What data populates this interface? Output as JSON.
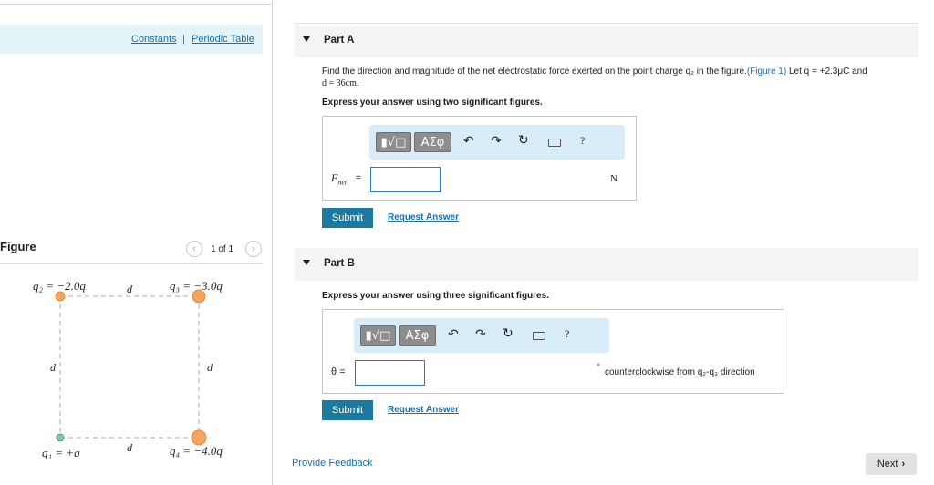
{
  "links": {
    "constants": "Constants",
    "separator": "|",
    "periodic_table": "Periodic Table"
  },
  "figure": {
    "heading": "Figure",
    "pager": "1 of 1",
    "prev_icon": "chevron-left-icon",
    "next_icon": "chevron-right-icon",
    "q2": "q₂ = −2.0q",
    "q3": "q₃ = −3.0q",
    "q1": "q₁ = +q",
    "q4": "q₄ = −4.0q",
    "side_label": "d",
    "colors": {
      "negative_charge": "#f4a460",
      "positive_charge": "#7fc7b8",
      "dash": "#999999"
    }
  },
  "partA": {
    "title": "Part A",
    "question_main": "Find the direction and magnitude of the net electrostatic force exerted on the point charge q₂ in the figure.",
    "figure_ref": "(Figure 1)",
    "question_tail": " Let q = +2.3μC and",
    "question_line2": "d = 36cm.",
    "instruction": "Express your answer using two significant figures.",
    "var_label": "F",
    "var_sub": "net",
    "equals": "=",
    "unit": "N",
    "submit": "Submit",
    "request": "Request Answer"
  },
  "partB": {
    "title": "Part B",
    "instruction": "Express your answer using three significant figures.",
    "var_label": "θ =",
    "unit_degree": "°",
    "unit_text": "counterclockwise from q₂-q₃ direction",
    "submit": "Submit",
    "request": "Request Answer"
  },
  "toolbar": {
    "templates_icon": "templates-sqrt-icon",
    "greek": "ΑΣφ",
    "undo_icon": "undo-icon",
    "redo_icon": "redo-icon",
    "reset_icon": "reset-icon",
    "keyboard_icon": "keyboard-icon",
    "help": "?"
  },
  "footer": {
    "feedback": "Provide Feedback",
    "next": "Next"
  }
}
